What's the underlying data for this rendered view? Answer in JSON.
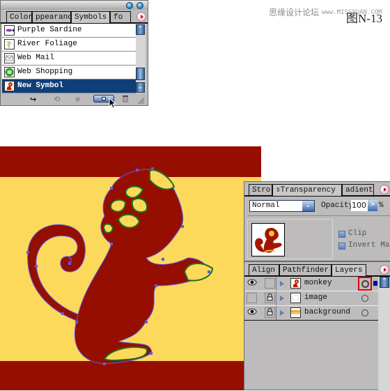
{
  "watermark": {
    "text": "思缘设计论坛",
    "url": "www.MISSYUAN.COM",
    "figure_label": "图N-13"
  },
  "symbols_panel": {
    "tabs": [
      {
        "label": "Color",
        "active": false
      },
      {
        "label": "Appearance",
        "display": "ppearanc",
        "active": false
      },
      {
        "label": "Symbols",
        "active": true
      },
      {
        "label": "Info",
        "display": "fo",
        "active": false
      }
    ],
    "items": [
      {
        "label": "Purple Sardine",
        "icon": "fish-icon",
        "selected": false
      },
      {
        "label": "River Foliage",
        "icon": "foliage-icon",
        "selected": false
      },
      {
        "label": "Web Mail",
        "icon": "mail-icon",
        "selected": false
      },
      {
        "label": "Web Shopping",
        "icon": "shopping-icon",
        "selected": false
      },
      {
        "label": "New Symbol",
        "icon": "monkey-icon",
        "selected": true
      }
    ],
    "bottom_buttons": [
      {
        "name": "place-symbol-instance",
        "glyph": "↪"
      },
      {
        "name": "replace-symbol",
        "glyph": "⟲"
      },
      {
        "name": "break-link",
        "glyph": "⋇"
      },
      {
        "name": "new-symbol",
        "glyph": "▣"
      },
      {
        "name": "delete-symbol",
        "glyph": "🗑"
      }
    ]
  },
  "transparency_panel": {
    "tabs": [
      {
        "label": "Stroke",
        "display": "Strol",
        "active": false
      },
      {
        "label": "Transparency",
        "display": "⇕Transparency",
        "active": true
      },
      {
        "label": "Gradient",
        "display": "adient",
        "active": false
      }
    ],
    "blend_mode": "Normal",
    "opacity_label": "Opacity",
    "opacity_value": "100",
    "opacity_unit": "%",
    "clip_label": "Clip",
    "invert_mask_label": "Invert Mask",
    "invert_mask_display": "Invert Mas"
  },
  "layers_panel": {
    "tabs": [
      {
        "label": "Align",
        "active": false
      },
      {
        "label": "Pathfinder",
        "active": false
      },
      {
        "label": "Layers",
        "active": true
      }
    ],
    "layers": [
      {
        "name": "monkey",
        "visible": true,
        "locked": false,
        "targeted": true,
        "selected_color": "#0000aa"
      },
      {
        "name": "image",
        "visible": false,
        "locked": true,
        "targeted": false
      },
      {
        "name": "background",
        "visible": true,
        "locked": true,
        "targeted": false
      }
    ]
  },
  "colors": {
    "selection_blue": "#0f3f78",
    "artwork_red": "#960e00",
    "artwork_yellow": "#fcd95a",
    "anchor_blue": "#5a5af0",
    "anchor_green": "#1d6e1d",
    "highlight_red": "#e00000"
  }
}
